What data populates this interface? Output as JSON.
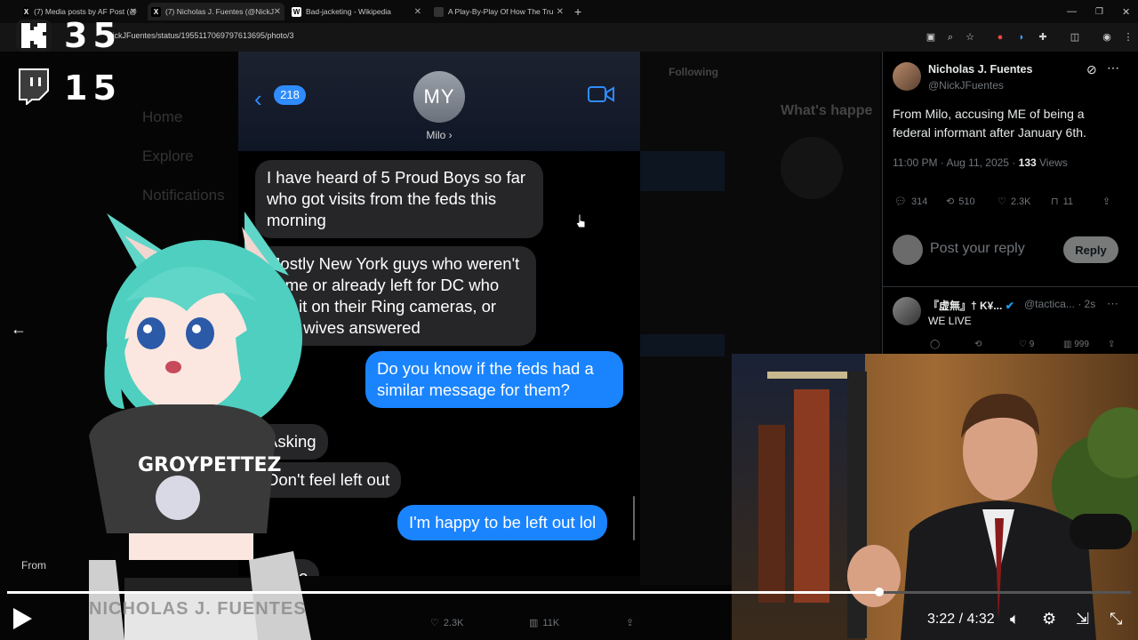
{
  "browser": {
    "tabs": [
      {
        "title": "(7) Media posts by AF Post (@",
        "favicon": "X"
      },
      {
        "title": "(7) Nicholas J. Fuentes (@NickJ",
        "favicon": "X"
      },
      {
        "title": "Bad-jacketing - Wikipedia",
        "favicon": "W"
      },
      {
        "title": "A Play-By-Play Of How The Tru",
        "favicon": ""
      }
    ],
    "new_tab": "+",
    "url": "NickJFuentes/status/1955117069797613695/photo/3"
  },
  "stream": {
    "kick_count": "35",
    "twitch_count": "15"
  },
  "messages": {
    "back_count": "218",
    "avatar_initials": "MY",
    "contact_name": "Milo ›",
    "bubbles": [
      {
        "dir": "in",
        "text": "I have heard of 5 Proud Boys so far who got visits from the feds this morning"
      },
      {
        "dir": "in",
        "text": "Mostly New York guys who weren't home or already left for DC who had it on their Ring cameras, or their wives answered"
      },
      {
        "dir": "out",
        "text": "Do you know if the feds had a similar message for them?"
      },
      {
        "dir": "in",
        "text": "Asking"
      },
      {
        "dir": "in",
        "text": "Don't feel left out"
      },
      {
        "dir": "out",
        "text": "I'm happy to be left out lol"
      },
      {
        "dir": "in",
        "text": "Lmao"
      }
    ]
  },
  "tweet": {
    "author_name": "Nicholas J. Fuentes",
    "author_handle": "@NickJFuentes",
    "text": "From Milo, accusing ME of being a federal informant after January 6th.",
    "time": "11:00 PM · Aug 11, 2025 · ",
    "views_count": "133",
    "views_label": " Views",
    "replies": "314",
    "reposts": "510",
    "likes": "2.3K",
    "bookmarks": "11",
    "reply_placeholder": "Post your reply",
    "reply_button": "Reply"
  },
  "reply2": {
    "name": "『虚無』† K¥...",
    "handle": "@tactica... · 2s",
    "text": "WE LIVE",
    "likes": "9",
    "views": "999"
  },
  "background_ui": {
    "nav": [
      "Home",
      "Explore",
      "Notifications"
    ],
    "following": "Following",
    "whats_happening": "What's happe",
    "from_label": "From",
    "name_banner": "NICHOLAS J. FUENTES",
    "likes": "2.3K",
    "views": "11K"
  },
  "player": {
    "time": "3:22 / 4:32",
    "progress": 0.776
  }
}
